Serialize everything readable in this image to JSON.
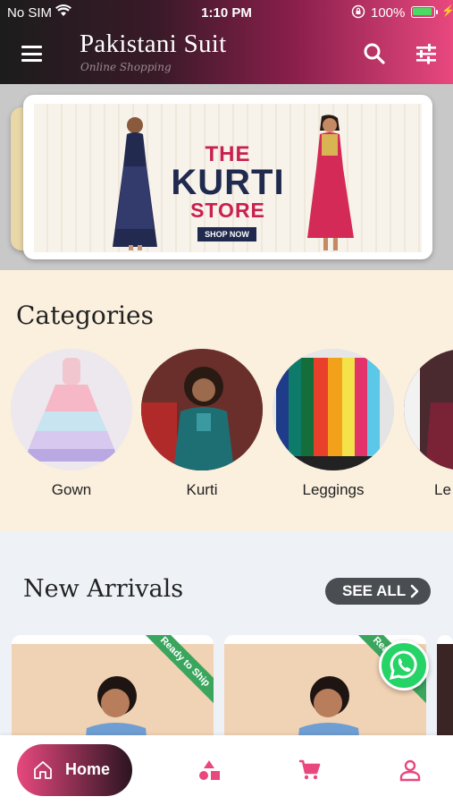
{
  "status_bar": {
    "carrier": "No SIM",
    "time": "1:10 PM",
    "battery": "100%"
  },
  "app_bar": {
    "title": "Pakistani Suit",
    "subtitle": "Online Shopping",
    "menu_icon": "hamburger-menu-icon",
    "search_icon": "search-icon",
    "filter_icon": "filter-sliders-icon",
    "gradient": [
      "#1c1c1c",
      "#e8487e"
    ]
  },
  "banner": {
    "line1": "THE",
    "line2": "KURTI",
    "line3": "STORE",
    "button": "SHOP NOW"
  },
  "categories": {
    "title": "Categories",
    "items": [
      {
        "label": "Gown"
      },
      {
        "label": "Kurti"
      },
      {
        "label": "Leggings"
      },
      {
        "label": "Le"
      }
    ]
  },
  "new_arrivals": {
    "title": "New Arrivals",
    "see_all": "SEE ALL",
    "badge": "Ready to Ship"
  },
  "bottom_nav": {
    "home": "Home",
    "accent": "#e8487e",
    "items": [
      "home-icon",
      "categories-shapes-icon",
      "cart-icon",
      "profile-icon"
    ]
  }
}
